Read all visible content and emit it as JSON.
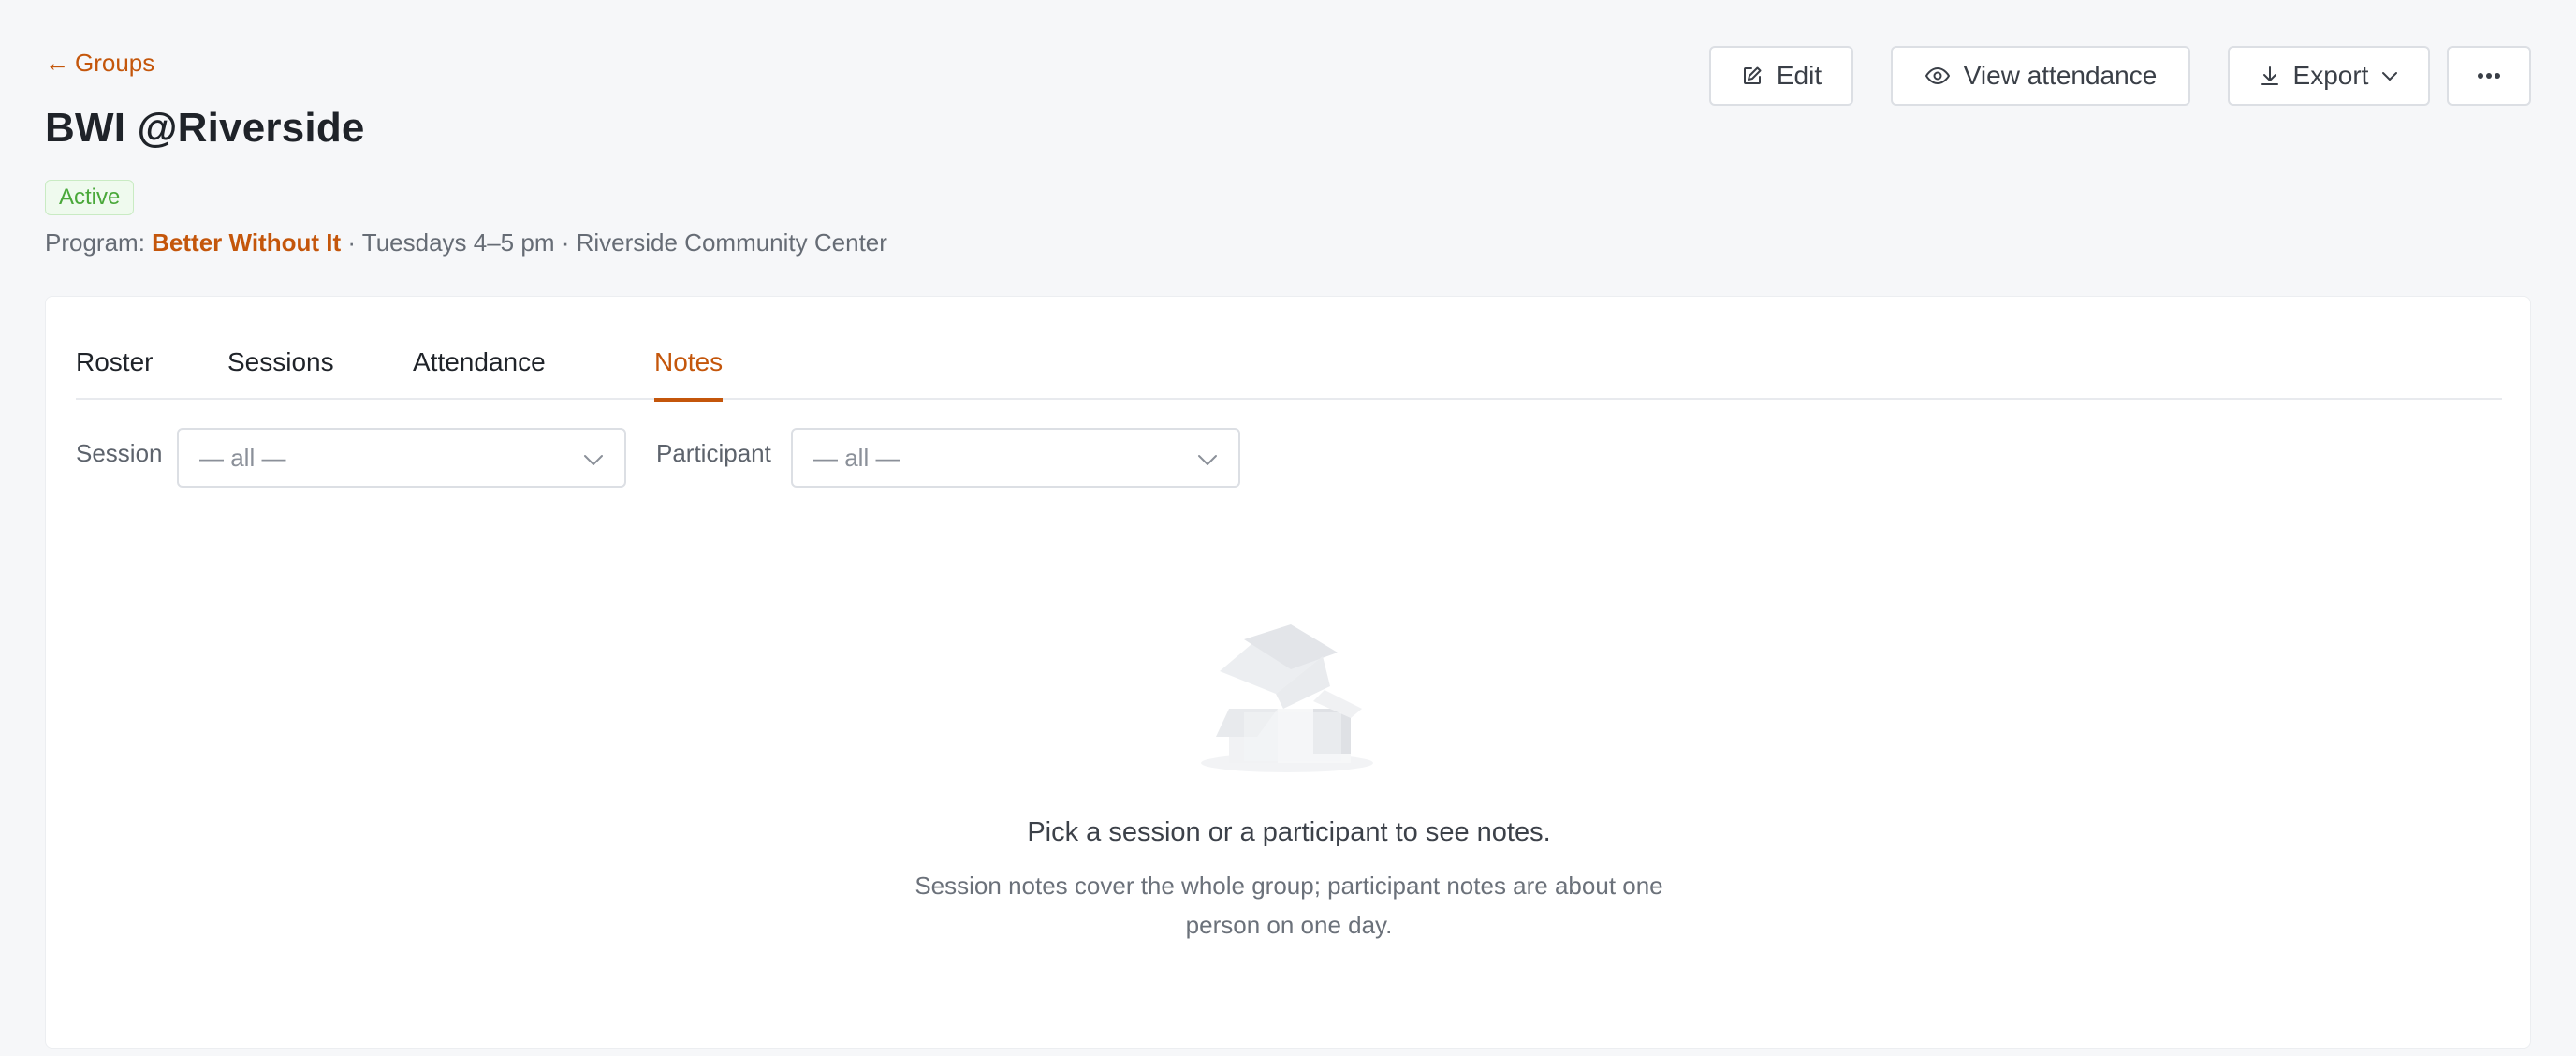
{
  "nav": {
    "back_arrow": "←",
    "back_label": "Groups"
  },
  "group": {
    "title": "BWI @Riverside",
    "status": "Active",
    "program_prefix": "Program:",
    "program_name": "Better Without It",
    "schedule": "· Tuesdays 4–5 pm · Riverside Community Center"
  },
  "actions": {
    "edit_label": "Edit",
    "view_attendance_label": "View attendance",
    "export_label": "Export",
    "more_icon": "ellipsis-icon"
  },
  "tabs": [
    {
      "label": "Roster",
      "active": false
    },
    {
      "label": "Sessions",
      "active": false
    },
    {
      "label": "Attendance",
      "active": false
    },
    {
      "label": "Notes",
      "active": true
    }
  ],
  "filters": {
    "session_label": "Session",
    "session_value": "— all —",
    "participant_label": "Participant",
    "participant_value": "— all —"
  },
  "empty_state": {
    "illustration": "empty-box-icon",
    "title": "Pick a session or a participant to see notes.",
    "subtitle": "Session notes cover the whole group; participant notes are about one person on one day."
  },
  "colors": {
    "accent": "#c4560b",
    "status_green": "#4aa83a",
    "status_bg": "#effaee",
    "background": "#f6f7f9"
  }
}
